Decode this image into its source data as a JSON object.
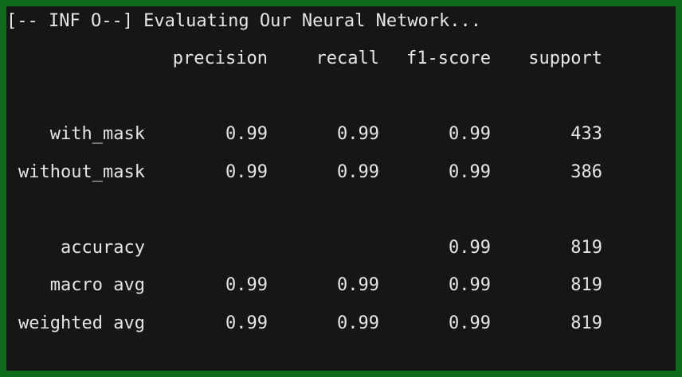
{
  "terminal": {
    "title_line": "[-- INF O--] Evaluating Our Neural Network...",
    "header": {
      "label": "",
      "precision": "precision",
      "recall": "recall",
      "f1": "f1-score",
      "support": "support"
    },
    "rows": [
      {
        "label": "with_mask",
        "precision": "0.99",
        "recall": "0.99",
        "f1": "0.99",
        "support": "433"
      },
      {
        "label": "without_mask",
        "precision": "0.99",
        "recall": "0.99",
        "f1": "0.99",
        "support": "386"
      }
    ],
    "summary": [
      {
        "label": "accuracy",
        "precision": "",
        "recall": "",
        "f1": "0.99",
        "support": "819"
      },
      {
        "label": "macro avg",
        "precision": "0.99",
        "recall": "0.99",
        "f1": "0.99",
        "support": "819"
      },
      {
        "label": "weighted avg",
        "precision": "0.99",
        "recall": "0.99",
        "f1": "0.99",
        "support": "819"
      }
    ]
  },
  "colors": {
    "frame": "#0f6b1c",
    "background": "#161616",
    "text": "#e6e6e6"
  }
}
